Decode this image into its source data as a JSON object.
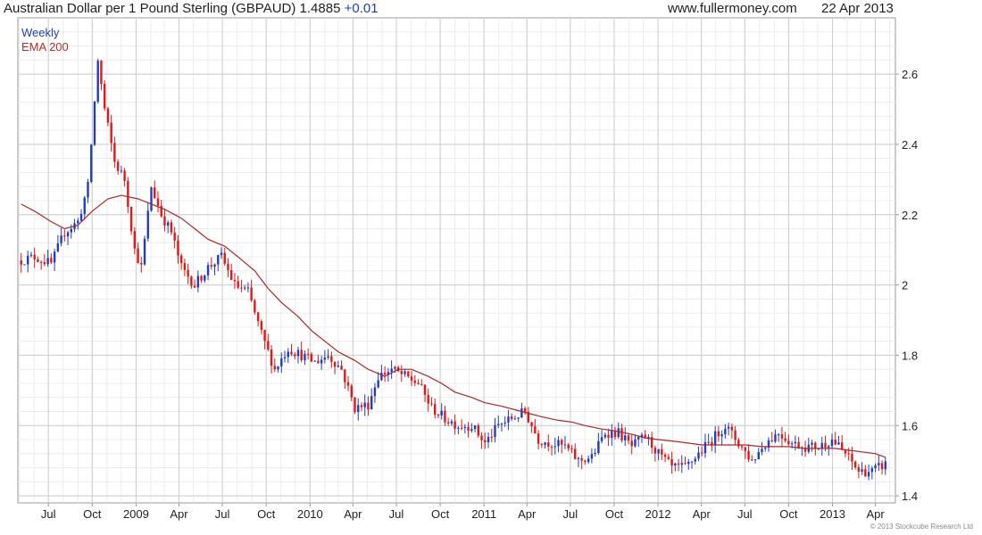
{
  "header": {
    "title": "Australian Dollar per 1 Pound Sterling (GBPAUD) 1.4885",
    "change": "+0.01",
    "site": "www.fullermoney.com",
    "date": "22 Apr 2013"
  },
  "footer": {
    "copyright": "© 2013 Stockcube Research Ltd"
  },
  "colors": {
    "up": "#1f3fbf",
    "down": "#e01818",
    "ema": "#a82828",
    "grid": "#cccccc",
    "axis": "#999999"
  },
  "chart_data": {
    "type": "candlestick",
    "legend": [
      "Weekly",
      "EMA 200"
    ],
    "ylim": [
      1.38,
      2.76
    ],
    "yticks": [
      1.4,
      1.6,
      1.8,
      2,
      2.2,
      2.4,
      2.6
    ],
    "ytick_labels": [
      "1.4",
      "1.6",
      "1.8",
      "2",
      "2.2",
      "2.4",
      "2.6"
    ],
    "xlim": [
      "2008-04-28",
      "2013-05-13"
    ],
    "xticks": [
      {
        "date": "2008-07-01",
        "label": "Jul"
      },
      {
        "date": "2008-10-01",
        "label": "Oct"
      },
      {
        "date": "2009-01-01",
        "label": "2009"
      },
      {
        "date": "2009-04-01",
        "label": "Apr"
      },
      {
        "date": "2009-07-01",
        "label": "Jul"
      },
      {
        "date": "2009-10-01",
        "label": "Oct"
      },
      {
        "date": "2010-01-01",
        "label": "2010"
      },
      {
        "date": "2010-04-01",
        "label": "Apr"
      },
      {
        "date": "2010-07-01",
        "label": "Jul"
      },
      {
        "date": "2010-10-01",
        "label": "Oct"
      },
      {
        "date": "2011-01-01",
        "label": "2011"
      },
      {
        "date": "2011-04-01",
        "label": "Apr"
      },
      {
        "date": "2011-07-01",
        "label": "Jul"
      },
      {
        "date": "2011-10-01",
        "label": "Oct"
      },
      {
        "date": "2012-01-01",
        "label": "2012"
      },
      {
        "date": "2012-04-01",
        "label": "Apr"
      },
      {
        "date": "2012-07-01",
        "label": "Jul"
      },
      {
        "date": "2012-10-01",
        "label": "Oct"
      },
      {
        "date": "2013-01-01",
        "label": "2013"
      },
      {
        "date": "2013-04-01",
        "label": "Apr"
      }
    ],
    "series": [
      {
        "name": "Weekly",
        "kind": "close_path",
        "x": [
          "2008-05-05",
          "2008-06-02",
          "2008-07-07",
          "2008-08-04",
          "2008-09-01",
          "2008-09-22",
          "2008-10-13",
          "2008-10-27",
          "2008-11-17",
          "2008-12-08",
          "2008-12-29",
          "2009-01-12",
          "2009-02-02",
          "2009-02-23",
          "2009-03-16",
          "2009-04-06",
          "2009-05-04",
          "2009-06-01",
          "2009-06-29",
          "2009-07-27",
          "2009-08-24",
          "2009-09-21",
          "2009-10-19",
          "2009-11-16",
          "2009-12-14",
          "2010-01-11",
          "2010-02-08",
          "2010-03-08",
          "2010-04-05",
          "2010-05-03",
          "2010-05-24",
          "2010-06-21",
          "2010-07-19",
          "2010-08-16",
          "2010-09-13",
          "2010-10-11",
          "2010-11-08",
          "2010-12-06",
          "2011-01-03",
          "2011-01-31",
          "2011-02-28",
          "2011-03-28",
          "2011-04-25",
          "2011-05-23",
          "2011-06-20",
          "2011-07-18",
          "2011-08-15",
          "2011-09-12",
          "2011-10-10",
          "2011-11-07",
          "2011-12-05",
          "2012-01-02",
          "2012-01-30",
          "2012-02-27",
          "2012-03-26",
          "2012-04-23",
          "2012-05-21",
          "2012-06-18",
          "2012-07-16",
          "2012-08-13",
          "2012-09-10",
          "2012-10-08",
          "2012-11-05",
          "2012-12-03",
          "2012-12-31",
          "2013-01-28",
          "2013-02-25",
          "2013-03-25",
          "2013-04-22"
        ],
        "close": [
          2.07,
          2.08,
          2.06,
          2.15,
          2.18,
          2.28,
          2.64,
          2.5,
          2.35,
          2.3,
          2.1,
          2.05,
          2.28,
          2.2,
          2.15,
          2.05,
          2.0,
          2.05,
          2.08,
          2.0,
          1.98,
          1.86,
          1.76,
          1.82,
          1.8,
          1.78,
          1.8,
          1.76,
          1.65,
          1.66,
          1.74,
          1.76,
          1.74,
          1.72,
          1.65,
          1.62,
          1.6,
          1.6,
          1.55,
          1.6,
          1.62,
          1.64,
          1.56,
          1.55,
          1.54,
          1.5,
          1.51,
          1.58,
          1.58,
          1.54,
          1.57,
          1.52,
          1.48,
          1.48,
          1.52,
          1.56,
          1.6,
          1.55,
          1.5,
          1.55,
          1.58,
          1.55,
          1.54,
          1.54,
          1.56,
          1.52,
          1.47,
          1.47,
          1.49
        ]
      },
      {
        "name": "EMA 200",
        "kind": "line",
        "x": [
          "2008-05-05",
          "2008-06-02",
          "2008-07-07",
          "2008-08-04",
          "2008-09-01",
          "2008-10-01",
          "2008-11-03",
          "2008-12-01",
          "2009-01-05",
          "2009-02-02",
          "2009-03-02",
          "2009-04-06",
          "2009-05-04",
          "2009-06-01",
          "2009-07-06",
          "2009-08-03",
          "2009-09-07",
          "2009-10-05",
          "2009-11-02",
          "2009-12-07",
          "2010-01-04",
          "2010-02-01",
          "2010-03-01",
          "2010-04-05",
          "2010-05-03",
          "2010-06-07",
          "2010-07-05",
          "2010-08-02",
          "2010-09-06",
          "2010-10-04",
          "2010-11-01",
          "2010-12-06",
          "2011-01-03",
          "2011-02-07",
          "2011-03-07",
          "2011-04-04",
          "2011-05-02",
          "2011-06-06",
          "2011-07-04",
          "2011-08-01",
          "2011-09-05",
          "2011-10-03",
          "2011-11-07",
          "2011-12-05",
          "2012-01-02",
          "2012-02-06",
          "2012-03-05",
          "2012-04-02",
          "2012-05-07",
          "2012-06-04",
          "2012-07-02",
          "2012-08-06",
          "2012-09-03",
          "2012-10-01",
          "2012-11-05",
          "2012-12-03",
          "2013-01-07",
          "2013-02-04",
          "2013-03-04",
          "2013-04-01",
          "2013-04-22"
        ],
        "values": [
          2.23,
          2.21,
          2.18,
          2.16,
          2.17,
          2.21,
          2.245,
          2.255,
          2.245,
          2.23,
          2.215,
          2.19,
          2.16,
          2.13,
          2.11,
          2.08,
          2.04,
          1.99,
          1.95,
          1.91,
          1.87,
          1.84,
          1.81,
          1.785,
          1.76,
          1.74,
          1.76,
          1.76,
          1.74,
          1.72,
          1.695,
          1.68,
          1.665,
          1.655,
          1.645,
          1.635,
          1.625,
          1.615,
          1.61,
          1.6,
          1.59,
          1.585,
          1.575,
          1.565,
          1.56,
          1.555,
          1.55,
          1.545,
          1.545,
          1.545,
          1.545,
          1.54,
          1.54,
          1.54,
          1.535,
          1.535,
          1.535,
          1.53,
          1.525,
          1.52,
          1.51
        ]
      }
    ]
  }
}
